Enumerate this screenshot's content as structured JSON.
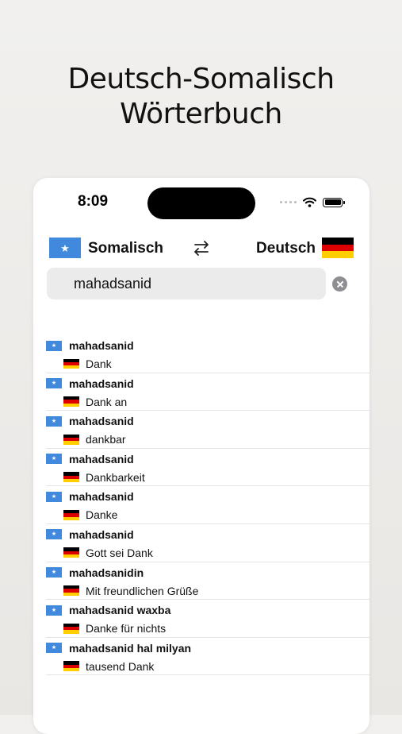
{
  "promo": {
    "title_line1": "Deutsch-Somalisch",
    "title_line2": "Wörterbuch"
  },
  "status_bar": {
    "time": "8:09"
  },
  "languages": {
    "from": "Somalisch",
    "to": "Deutsch",
    "from_flag_icon": "flag-somalia-icon",
    "to_flag_icon": "flag-germany-icon",
    "swap_icon": "swap-arrows-icon"
  },
  "search": {
    "value": "mahadsanid",
    "clear_icon": "clear-circle-icon"
  },
  "colors": {
    "somalia_blue": "#4189dd",
    "germany_black": "#000000",
    "germany_red": "#dd0000",
    "germany_gold": "#ffce00"
  },
  "results": [
    {
      "so": "mahadsanid",
      "de": "Dank"
    },
    {
      "so": "mahadsanid",
      "de": "Dank an"
    },
    {
      "so": "mahadsanid",
      "de": "dankbar"
    },
    {
      "so": "mahadsanid",
      "de": "Dankbarkeit"
    },
    {
      "so": "mahadsanid",
      "de": "Danke"
    },
    {
      "so": "mahadsanid",
      "de": "Gott sei Dank"
    },
    {
      "so": "mahadsanidin",
      "de": "Mit freundlichen Grüße"
    },
    {
      "so": "mahadsanid waxba",
      "de": "Danke für nichts"
    },
    {
      "so": "mahadsanid hal milyan",
      "de": "tausend Dank"
    }
  ]
}
